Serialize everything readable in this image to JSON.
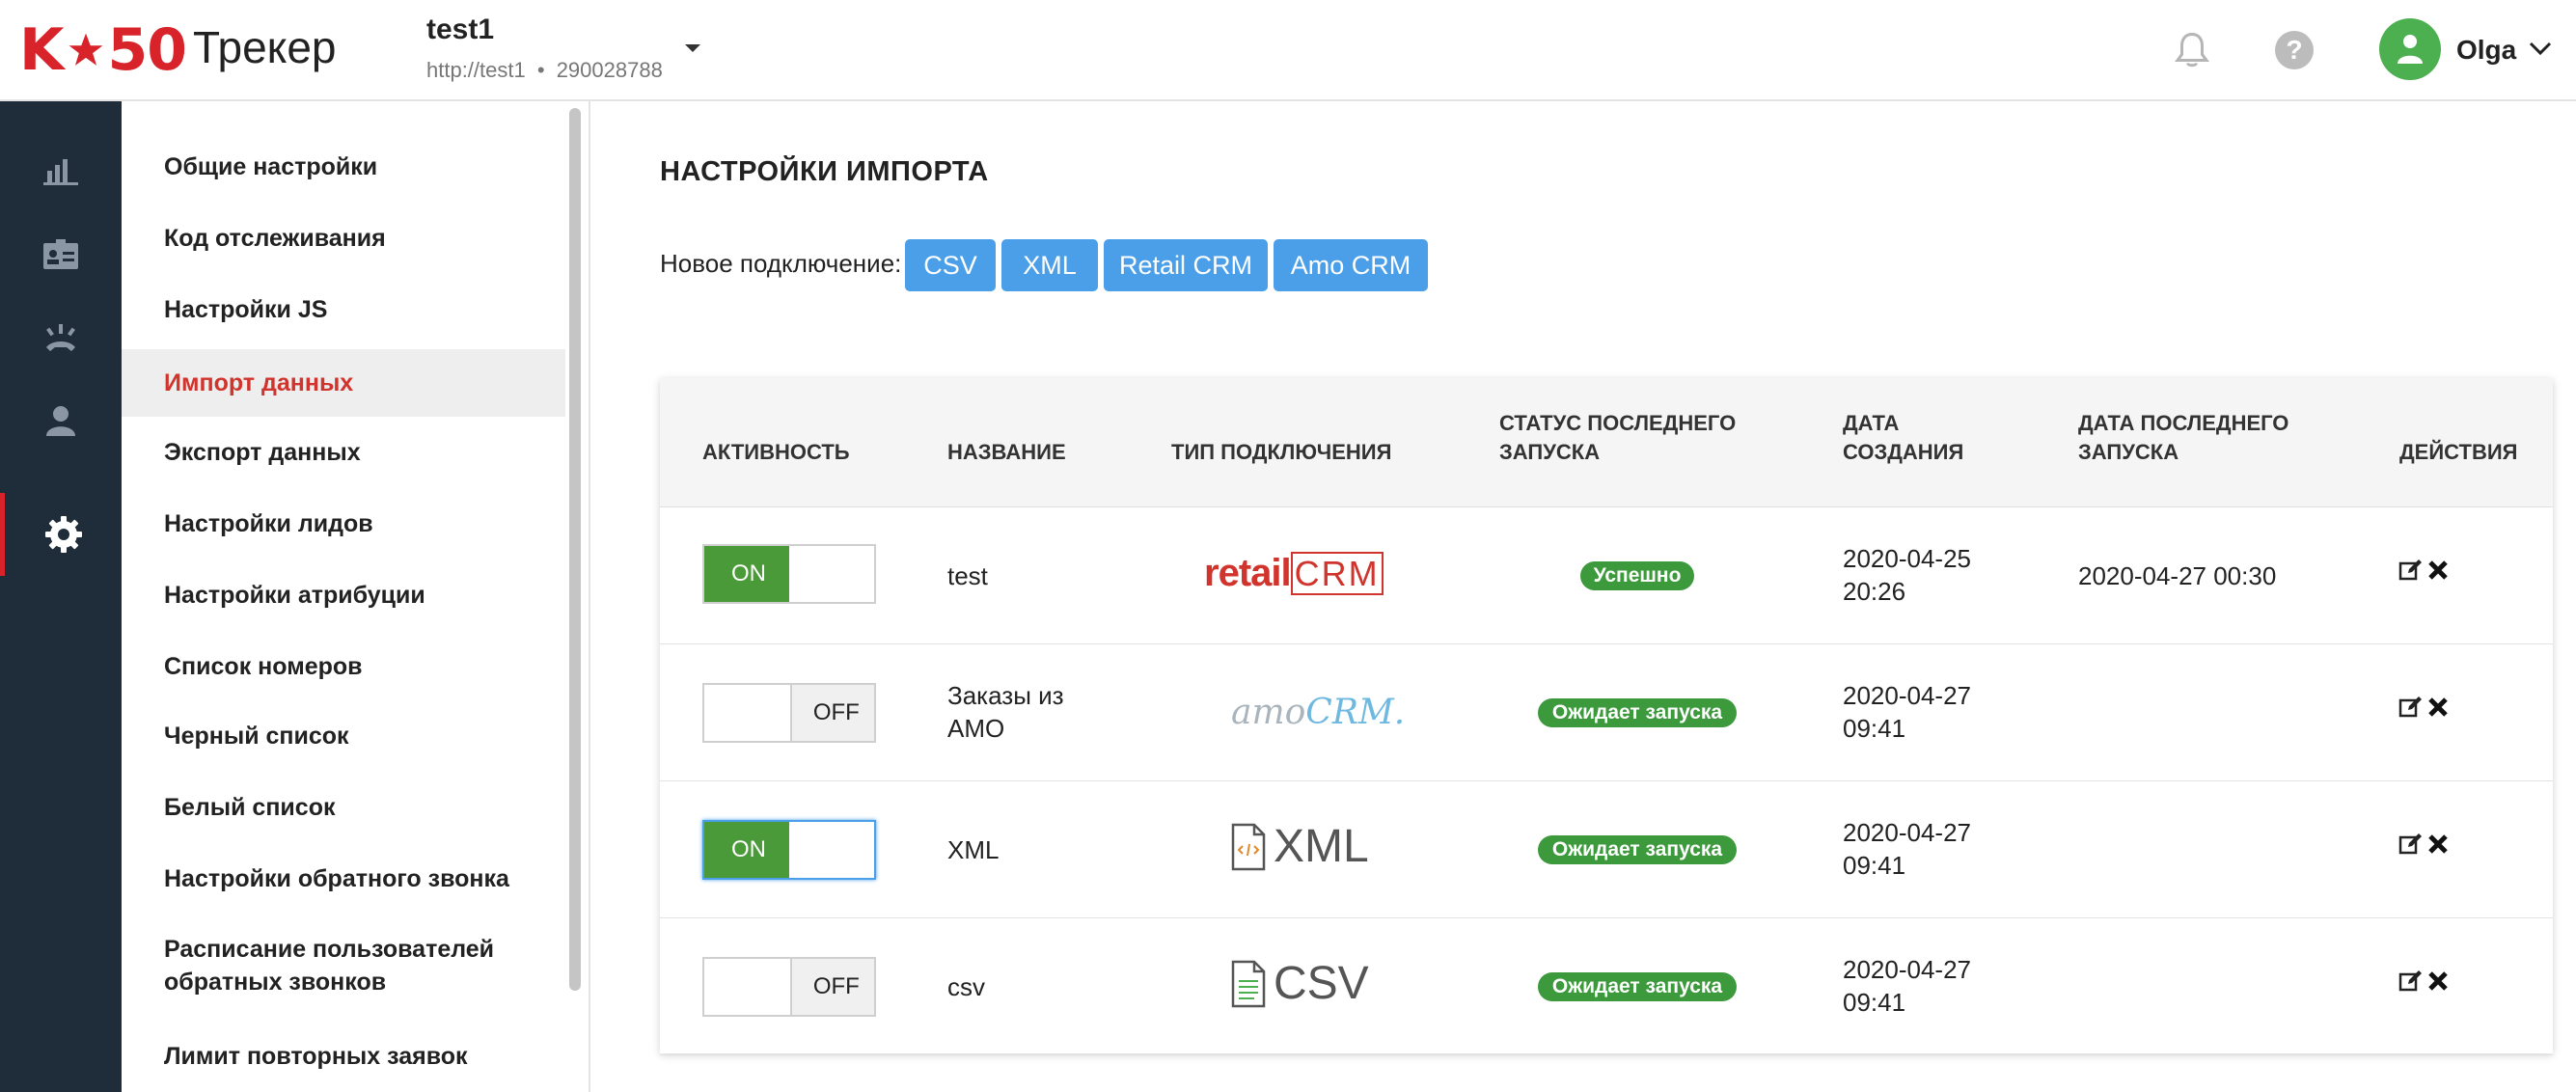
{
  "header": {
    "logo_text_left": "K",
    "logo_text_right": "50",
    "brand": "Трекер",
    "project_name": "test1",
    "project_url": "http://test1",
    "project_sep": "•",
    "project_id": "290028788",
    "help_glyph": "?",
    "user_name": "Olga"
  },
  "rail": {
    "items": [
      {
        "icon": "bar-chart-icon"
      },
      {
        "icon": "id-card-icon"
      },
      {
        "icon": "phone-signal-icon"
      },
      {
        "icon": "user-icon"
      },
      {
        "icon": "gear-icon",
        "active": true
      }
    ]
  },
  "nav": {
    "items": [
      {
        "label": "Общие настройки"
      },
      {
        "label": "Код отслеживания"
      },
      {
        "label": "Настройки JS"
      },
      {
        "label": "Импорт данных",
        "active": true
      },
      {
        "label": "Экспорт данных"
      },
      {
        "label": "Настройки лидов"
      },
      {
        "label": "Настройки атрибуции"
      },
      {
        "label": "Список номеров"
      },
      {
        "label": "Черный список"
      },
      {
        "label": "Белый список"
      },
      {
        "label": "Настройки обратного звонка"
      },
      {
        "label_line1": "Расписание пользователей",
        "label_line2": "обратных звонков"
      },
      {
        "label": "Лимит повторных заявок"
      }
    ]
  },
  "main": {
    "title": "НАСТРОЙКИ ИМПОРТА",
    "new_connection_label": "Новое подключение:",
    "buttons": [
      "CSV",
      "XML",
      "Retail CRM",
      "Amo CRM"
    ],
    "accent_color": "#4a9fe8",
    "table": {
      "headers": {
        "activity": "АКТИВНОСТЬ",
        "name": "НАЗВАНИЕ",
        "type": "ТИП ПОДКЛЮЧЕНИЯ",
        "status_line1": "СТАТУС ПОСЛЕДНЕГО",
        "status_line2": "ЗАПУСКА",
        "created_line1": "ДАТА",
        "created_line2": "СОЗДАНИЯ",
        "last_run_line1": "ДАТА ПОСЛЕДНЕГО",
        "last_run_line2": "ЗАПУСКА",
        "actions": "ДЕЙСТВИЯ"
      },
      "rows": [
        {
          "active": true,
          "toggle_label": "ON",
          "name_line1": "test",
          "name_line2": "",
          "type": "retailCRM",
          "type_logo_main": "retail",
          "type_logo_crm": "CRM",
          "status": "Успешно",
          "created_date": "2020-04-25",
          "created_time": "20:26",
          "last_run": "2020-04-27 00:30"
        },
        {
          "active": false,
          "toggle_label": "OFF",
          "name_line1": "Заказы из",
          "name_line2": "AMO",
          "type": "amoCRM",
          "type_logo_main": "amo",
          "type_logo_crm": "CRM.",
          "status": "Ожидает запуска",
          "created_date": "2020-04-27",
          "created_time": "09:41",
          "last_run": ""
        },
        {
          "active": true,
          "toggle_label": "ON",
          "name_line1": "XML",
          "name_line2": "",
          "type": "XML",
          "status": "Ожидает запуска",
          "created_date": "2020-04-27",
          "created_time": "09:41",
          "last_run": ""
        },
        {
          "active": false,
          "toggle_label": "OFF",
          "name_line1": "csv",
          "name_line2": "",
          "type": "CSV",
          "status": "Ожидает запуска",
          "created_date": "2020-04-27",
          "created_time": "09:41",
          "last_run": ""
        }
      ]
    }
  }
}
